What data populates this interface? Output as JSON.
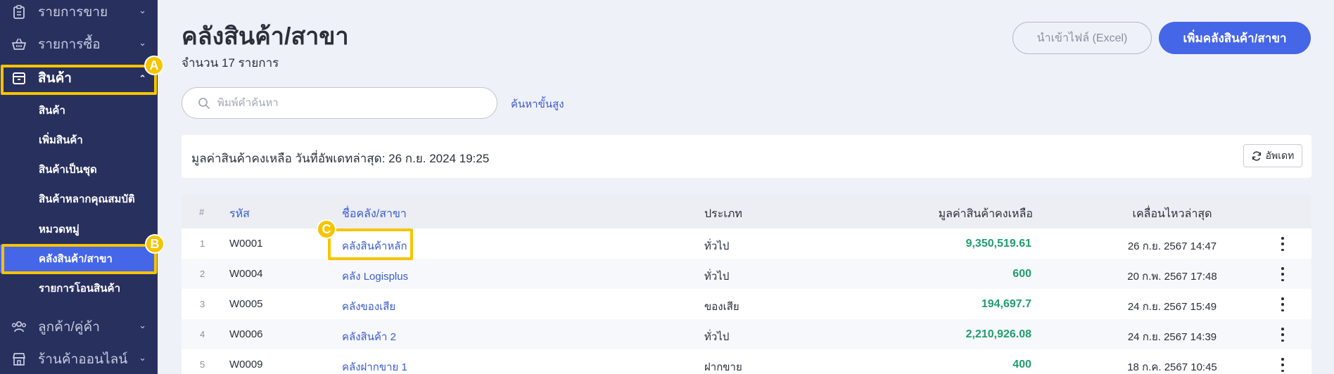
{
  "sidebar": {
    "items_top": [
      {
        "label": "รายการขาย",
        "icon": "clipboard-icon"
      },
      {
        "label": "รายการซื้อ",
        "icon": "basket-icon"
      },
      {
        "label": "สินค้า",
        "icon": "box-icon"
      }
    ],
    "sub_items": [
      "สินค้า",
      "เพิ่มสินค้า",
      "สินค้าเป็นชุด",
      "สินค้าหลากคุณสมบัติ",
      "หมวดหมู่",
      "คลังสินค้า/สาขา",
      "รายการโอนสินค้า"
    ],
    "items_bottom": [
      {
        "label": "ลูกค้า/คู่ค้า",
        "icon": "people-icon"
      },
      {
        "label": "ร้านค้าออนไลน์",
        "icon": "store-icon"
      }
    ],
    "chevron": "⌄",
    "chevron_up": "⌃"
  },
  "annotations": {
    "a": "A",
    "b": "B",
    "c": "C"
  },
  "header": {
    "title": "คลังสินค้า/สาขา",
    "count": "จำนวน 17 รายการ",
    "import_label": "นำเข้าไฟล์ (Excel)",
    "add_label": "เพิ่มคลังสินค้า/สาขา"
  },
  "search": {
    "placeholder": "พิมพ์คำค้นหา",
    "advanced_label": "ค้นหาขั้นสูง"
  },
  "value_card": {
    "text": "มูลค่าสินค้าคงเหลือ วันที่อัพเดทล่าสุด: 26 ก.ย. 2024 19:25",
    "refresh_label": "อัพเดท"
  },
  "table": {
    "headers": {
      "idx": "#",
      "code": "รหัส",
      "name": "ชื่อคลัง/สาขา",
      "type": "ประเภท",
      "value": "มูลค่าสินค้าคงเหลือ",
      "moved": "เคลื่อนไหวล่าสุด"
    },
    "rows": [
      {
        "idx": "1",
        "code": "W0001",
        "name": "คลังสินค้าหลัก",
        "type": "ทั่วไป",
        "value": "9,350,519.61",
        "moved": "26 ก.ย. 2567 14:47"
      },
      {
        "idx": "2",
        "code": "W0004",
        "name": "คลัง Logisplus",
        "type": "ทั่วไป",
        "value": "600",
        "moved": "20 ก.พ. 2567 17:48"
      },
      {
        "idx": "3",
        "code": "W0005",
        "name": "คลังของเสีย",
        "type": "ของเสีย",
        "value": "194,697.7",
        "moved": "24 ก.ย. 2567 15:49"
      },
      {
        "idx": "4",
        "code": "W0006",
        "name": "คลังสินค้า 2",
        "type": "ทั่วไป",
        "value": "2,210,926.08",
        "moved": "24 ก.ย. 2567 14:39"
      },
      {
        "idx": "5",
        "code": "W0009",
        "name": "คลังฝากขาย 1",
        "type": "ฝากขาย",
        "value": "400",
        "moved": "18 ก.ค. 2567 10:45"
      }
    ]
  },
  "colors": {
    "sidebar_bg": "#28305e",
    "accent": "#4666e8",
    "highlight": "#f6c400",
    "value_green": "#1f9e6b",
    "link_blue": "#3a5bd1"
  }
}
